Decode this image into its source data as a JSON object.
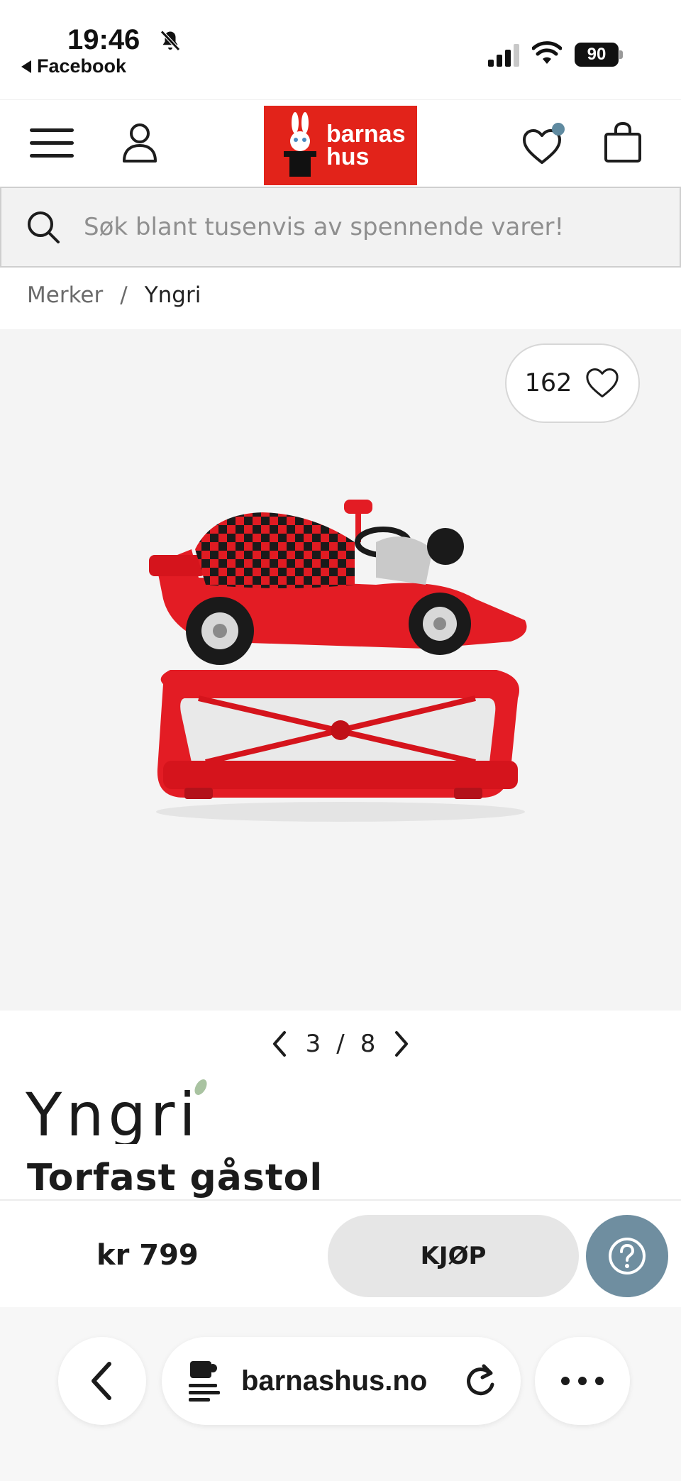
{
  "status_bar": {
    "time": "19:46",
    "back_app": "Facebook",
    "battery": "90"
  },
  "header": {
    "logo_line1": "barnas",
    "logo_line2": "hus"
  },
  "search": {
    "placeholder": "Søk blant tusenvis av spennende varer!"
  },
  "breadcrumb": {
    "items": [
      "Merker",
      "Yngri"
    ],
    "separator": "/"
  },
  "gallery": {
    "likes": "162",
    "current": "3",
    "separator": "/",
    "total": "8"
  },
  "product": {
    "brand": "Yngri",
    "title": "Torfast gåstol",
    "price": "kr 799",
    "buy_label": "KJØP"
  },
  "browser": {
    "url": "barnashus.no"
  },
  "colors": {
    "brand_red": "#e2231a",
    "accent_blue": "#6f8ea0",
    "product_red": "#e31c24"
  }
}
